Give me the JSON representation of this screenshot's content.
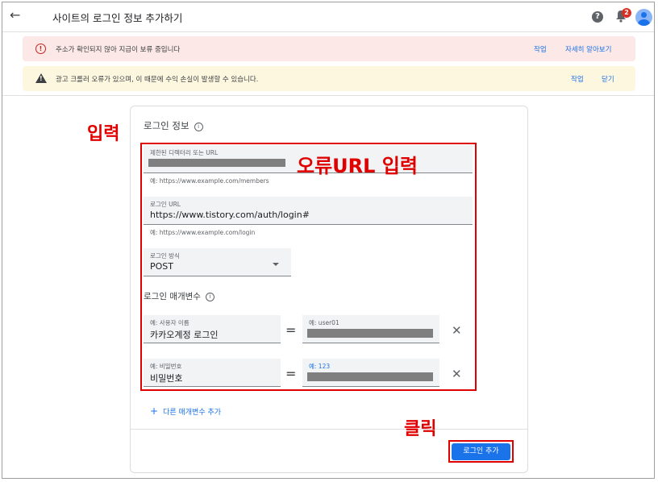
{
  "header": {
    "back_icon": "arrow-left-icon",
    "title": "사이트의 로그인 정보 추가하기",
    "help_icon": "help-icon",
    "notifications_badge": "2"
  },
  "banners": [
    {
      "message": "주소가 확인되지 않아 지급이 보류 중입니다",
      "action1": "작업",
      "action2": "자세히 알아보기",
      "icon": "error-icon",
      "color": "#fce8e6"
    },
    {
      "message": "광고 크롤러 오류가 있으며, 이 때문에 수익 손실이 발생할 수 있습니다.",
      "action1": "작업",
      "action2": "닫기",
      "icon": "warning-icon",
      "color": "#fef7e0"
    }
  ],
  "form": {
    "section_title": "로그인 정보",
    "restricted_url_label": "제한된 디렉터리 또는 URL",
    "restricted_url_hint": "예: https://www.example.com/members",
    "login_url_label": "로그인 URL",
    "login_url_value": "https://www.tistory.com/auth/login#",
    "login_url_hint": "예: https://www.example.com/login",
    "method_label": "로그인 방식",
    "method_value": "POST",
    "params_title": "로그인 매개변수",
    "params": [
      {
        "name_label": "예: 사용자 이름",
        "name_value": "카카오계정 로그인",
        "value_label": "예: user01"
      },
      {
        "name_label": "예: 비밀번호",
        "name_value": "비밀번호",
        "value_label": "예: 123"
      }
    ],
    "equals": "=",
    "add_param": "다른 매개변수 추가",
    "submit": "로그인 추가"
  },
  "annotations": {
    "input": "입력",
    "error_url": "오류URL 입력",
    "click": "클릭"
  },
  "colors": {
    "accent": "#1a73e8",
    "annotation": "#e00000"
  }
}
